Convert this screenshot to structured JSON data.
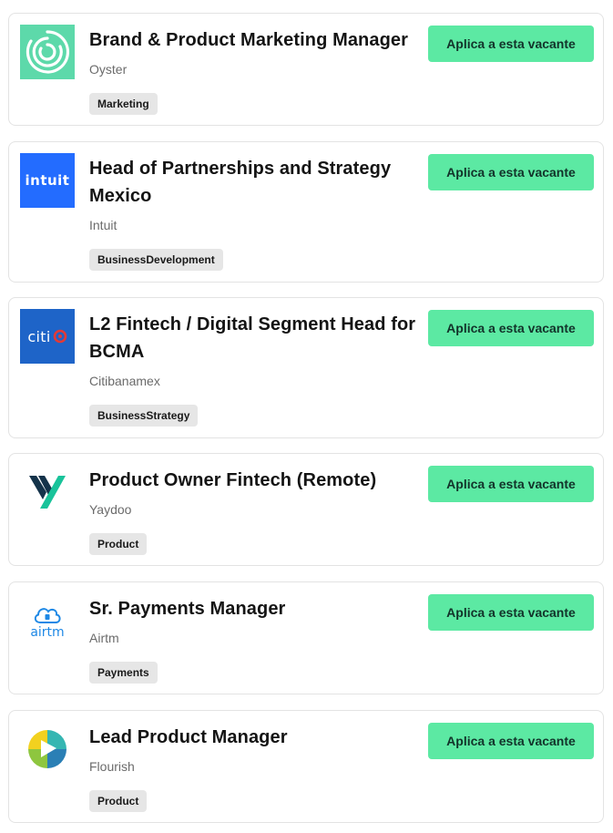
{
  "jobs": [
    {
      "title": "Brand & Product Marketing Manager",
      "company": "Oyster",
      "tag": "Marketing",
      "apply_label": "Aplica a esta vacante",
      "logo_icon": "oyster-rings-icon",
      "logo_bg": "#5dd9aa"
    },
    {
      "title": "Head of Partnerships and Strategy Mexico",
      "company": "Intuit",
      "tag": "BusinessDevelopment",
      "apply_label": "Aplica a esta vacante",
      "logo_icon": "intuit-wordmark-icon",
      "logo_text": "intuit",
      "logo_bg": "#236cff"
    },
    {
      "title": "L2 Fintech / Digital Segment Head for BCMA",
      "company": "Citibanamex",
      "tag": "BusinessStrategy",
      "apply_label": "Aplica a esta vacante",
      "logo_icon": "citi-wordmark-icon",
      "logo_text": "citi",
      "logo_bg": "#1e64c8"
    },
    {
      "title": "Product Owner Fintech (Remote)",
      "company": "Yaydoo",
      "tag": "Product",
      "apply_label": "Aplica a esta vacante",
      "logo_icon": "yaydoo-y-icon",
      "logo_bg": "#ffffff"
    },
    {
      "title": "Sr. Payments Manager",
      "company": "Airtm",
      "tag": "Payments",
      "apply_label": "Aplica a esta vacante",
      "logo_icon": "airtm-cloud-icon",
      "logo_text": "airtm",
      "logo_bg": "#ffffff"
    },
    {
      "title": "Lead Product Manager",
      "company": "Flourish",
      "tag": "Product",
      "apply_label": "Aplica a esta vacante",
      "logo_icon": "flourish-circle-icon",
      "logo_bg": "#ffffff"
    }
  ],
  "colors": {
    "apply_button": "#5ce9a3",
    "tag_bg": "#e6e6e6",
    "card_border": "#e3e3e3"
  }
}
